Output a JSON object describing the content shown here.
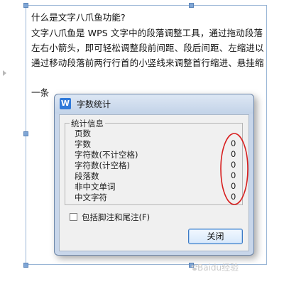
{
  "document": {
    "lines": [
      "什么是文字八爪鱼功能?",
      "文字八爪鱼是 WPS 文字中的段落调整工具，通过拖动段落",
      "左右小箭头，即可轻松调整段前间距、段后间距、左缩进以",
      "通过移动段落前两行行首的小竖线来调整首行缩进、悬挂缩",
      "一条"
    ]
  },
  "watermark": "Baidu经验",
  "dialog": {
    "title": "字数统计",
    "app_icon": "W",
    "group_label": "统计信息",
    "stats": [
      {
        "label": "页数",
        "value": ""
      },
      {
        "label": "字数",
        "value": "0"
      },
      {
        "label": "字符数(不计空格)",
        "value": "0"
      },
      {
        "label": "字符数(计空格)",
        "value": "0"
      },
      {
        "label": "段落数",
        "value": "0"
      },
      {
        "label": "非中文单词",
        "value": "0"
      },
      {
        "label": "中文字符",
        "value": "0"
      }
    ],
    "checkbox_label": "包括脚注和尾注(F)",
    "checkbox_checked": false,
    "close_label": "关闭"
  },
  "colors": {
    "annotation": "#d81e1e",
    "accent": "#3d7bc5",
    "app_icon": "#2f79d9"
  }
}
